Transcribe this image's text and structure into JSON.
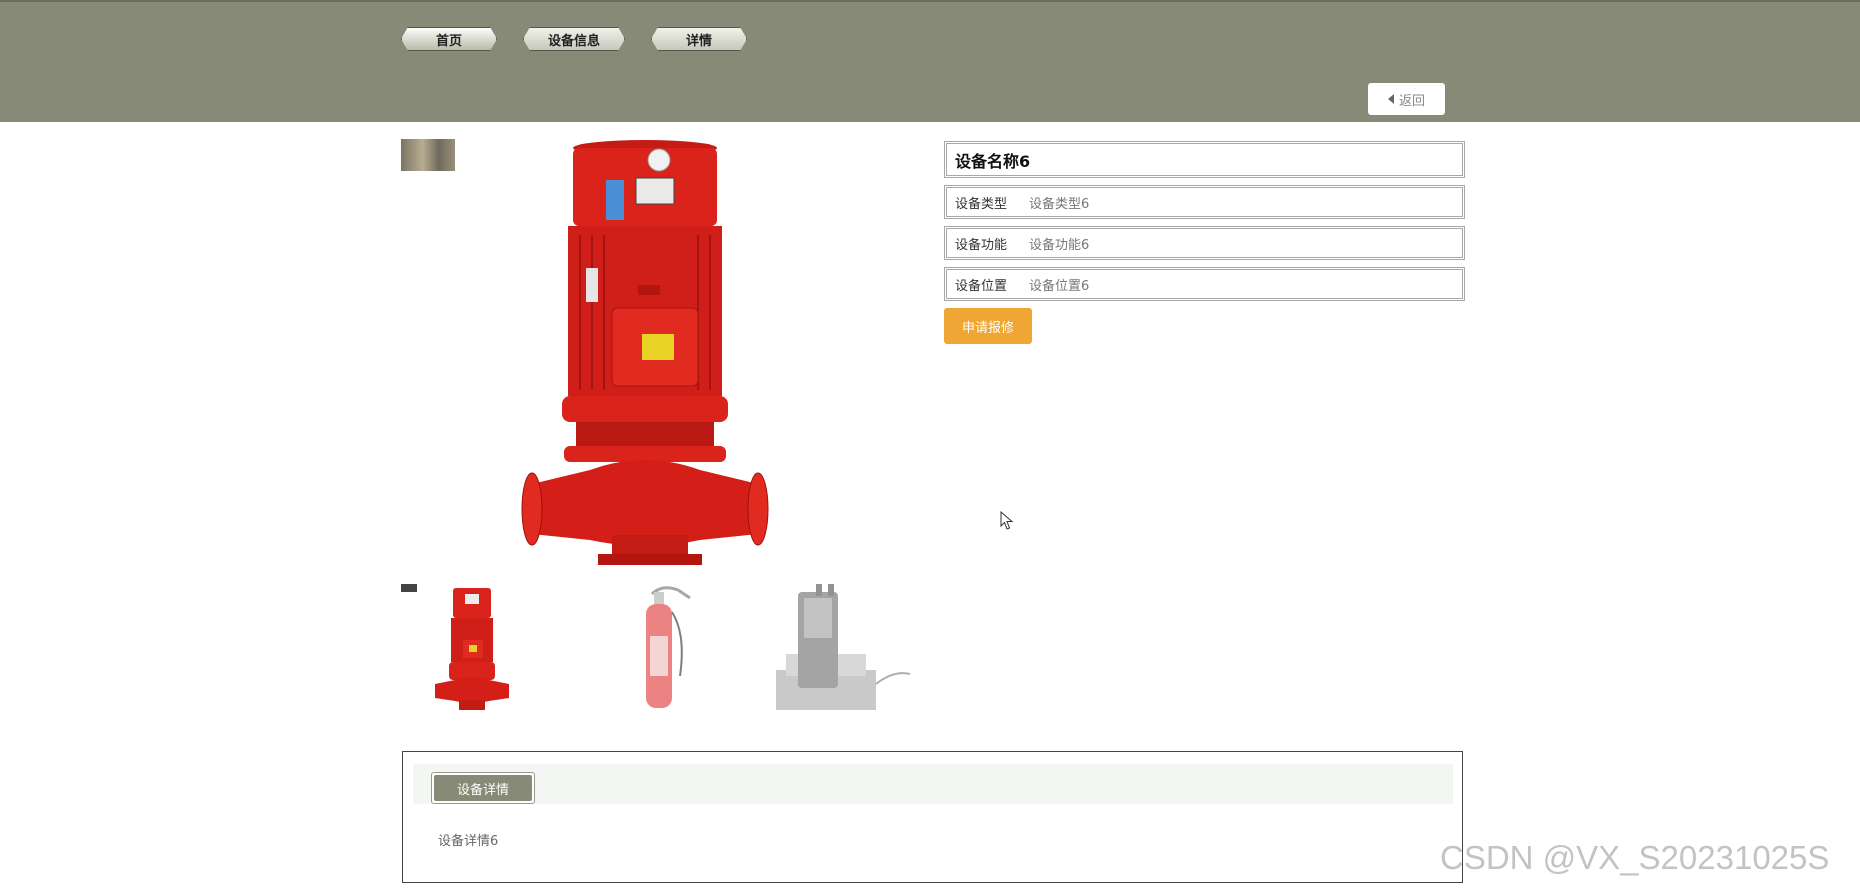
{
  "nav": {
    "tabs": [
      {
        "label": "首页"
      },
      {
        "label": "设备信息"
      },
      {
        "label": "详情"
      }
    ],
    "back_label": "返回"
  },
  "device": {
    "name": "设备名称6",
    "fields": [
      {
        "label": "设备类型",
        "value": "设备类型6"
      },
      {
        "label": "设备功能",
        "value": "设备功能6"
      },
      {
        "label": "设备位置",
        "value": "设备位置6"
      }
    ],
    "repair_label": "申请报修"
  },
  "gallery": {
    "main_image": "red-fire-pump",
    "thumbnails": [
      "red-fire-pump",
      "fire-extinguisher",
      "handheld-radio-charger"
    ]
  },
  "details": {
    "tab_label": "设备详情",
    "text": "设备详情6"
  },
  "watermark": "CSDN @VX_S20231025S",
  "colors": {
    "header": "#878a76",
    "repair_button": "#efa634",
    "pump_red": "#d9231b"
  }
}
